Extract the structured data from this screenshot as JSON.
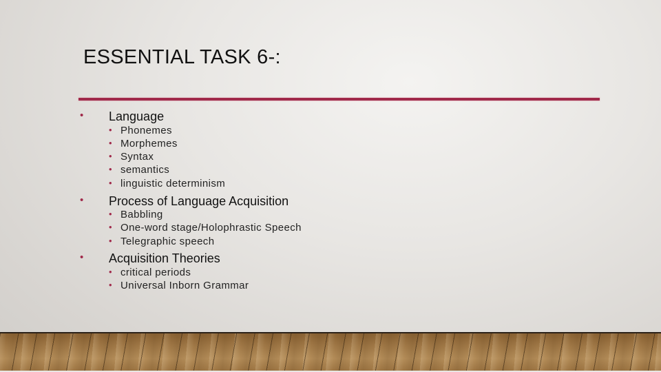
{
  "slide": {
    "title": "ESSENTIAL TASK 6-:",
    "accent_color": "#a0294a",
    "bullet_glyph": "•",
    "sections": [
      {
        "heading": "Language",
        "items": [
          "Phonemes",
          "Morphemes",
          "Syntax",
          "semantics",
          "linguistic determinism"
        ]
      },
      {
        "heading": "Process of Language Acquisition",
        "items": [
          "Babbling",
          "One-word stage/Holophrastic Speech",
          "Telegraphic speech"
        ]
      },
      {
        "heading": "Acquisition Theories",
        "items": [
          "critical periods",
          "Universal Inborn Grammar"
        ]
      }
    ]
  }
}
